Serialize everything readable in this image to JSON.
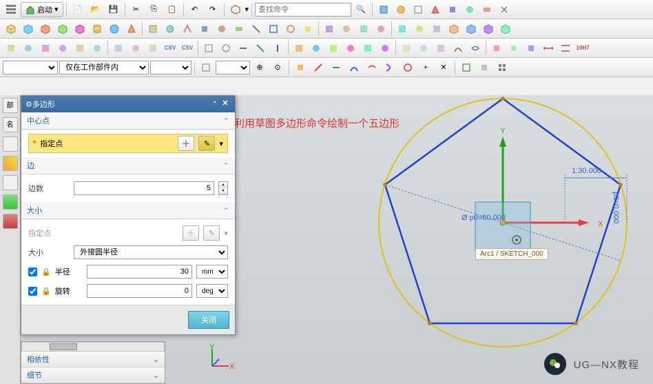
{
  "app": {
    "start_label": "启动"
  },
  "search": {
    "placeholder": "查找命令"
  },
  "filter": {
    "scope": "仅在工作部件内"
  },
  "dialog": {
    "title": "多边形",
    "section_center": "中心点",
    "specify_point": "指定点",
    "section_sides": "边",
    "sides_label": "边数",
    "sides_value": "5",
    "section_size": "大小",
    "specify_point2": "指定点",
    "size_label": "大小",
    "size_mode": "外接圆半径",
    "radius_label": "半径",
    "radius_value": "30",
    "radius_unit": "mm",
    "rotation_label": "旋转",
    "rotation_value": "0",
    "rotation_unit": "deg",
    "close_label": "关闭"
  },
  "panels": {
    "dependency": "相依性",
    "details": "细节"
  },
  "annotation": {
    "text": "利用草图多边形命令绘制一个五边形"
  },
  "canvas": {
    "arc_label": "Arc1 / SKETCH_000",
    "dim_diameter": "Ø p0=60.000",
    "dim_p1": "1:30.000",
    "dim_p3": "p3=0.000"
  },
  "watermark": {
    "text": "UG—NX教程"
  },
  "icons": {
    "gear": "gear-icon",
    "close": "close-icon",
    "restore": "restore-icon"
  }
}
